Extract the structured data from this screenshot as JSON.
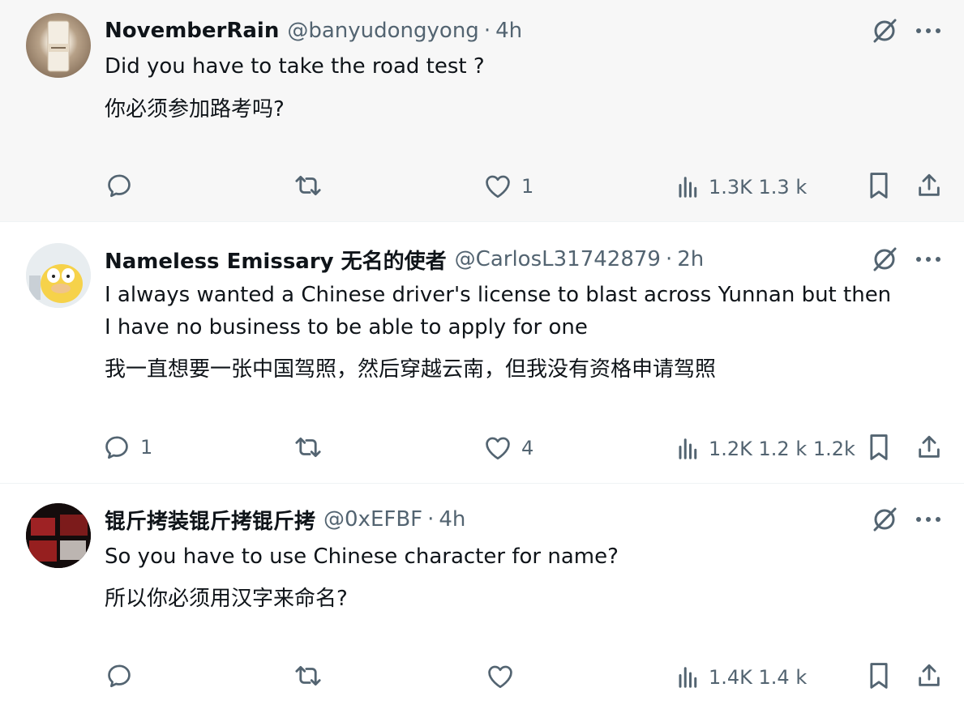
{
  "tweets": [
    {
      "name": "NovemberRain",
      "handle": "@banyudongyong",
      "separator": "·",
      "time": "4h",
      "text_en": "Did you have to take the road test ?",
      "text_zh": "你必须参加路考吗?",
      "likes": "1",
      "views": "1.3K 1.3 k"
    },
    {
      "name": "Nameless Emissary 无名的使者",
      "handle": "@CarlosL31742879",
      "separator": "·",
      "time": "2h",
      "text_en_line1": "I always wanted a Chinese driver's license to blast across Yunnan but then",
      "text_en_line2": "I have no business to be able to apply for one",
      "text_zh": "我一直想要一张中国驾照，然后穿越云南，但我没有资格申请驾照",
      "replies": "1",
      "likes": "4",
      "views": "1.2K 1.2 k 1.2k"
    },
    {
      "name": "锟斤拷装锟斤拷锟斤拷",
      "handle": "@0xEFBF",
      "separator": "·",
      "time": "4h",
      "text_en": "So you have to use Chinese character for name?",
      "text_zh": "所以你必须用汉字来命名?",
      "views": "1.4K 1.4 k"
    }
  ],
  "icons": {
    "reply": "reply-icon",
    "retweet": "retweet-icon",
    "like": "heart-icon",
    "views": "views-icon",
    "bookmark": "bookmark-icon",
    "share": "share-icon",
    "grok": "grok-icon",
    "more": "more-icon"
  },
  "colors": {
    "text": "#0f1419",
    "secondary": "#536471",
    "highlight_bg": "#f7f7f7"
  }
}
